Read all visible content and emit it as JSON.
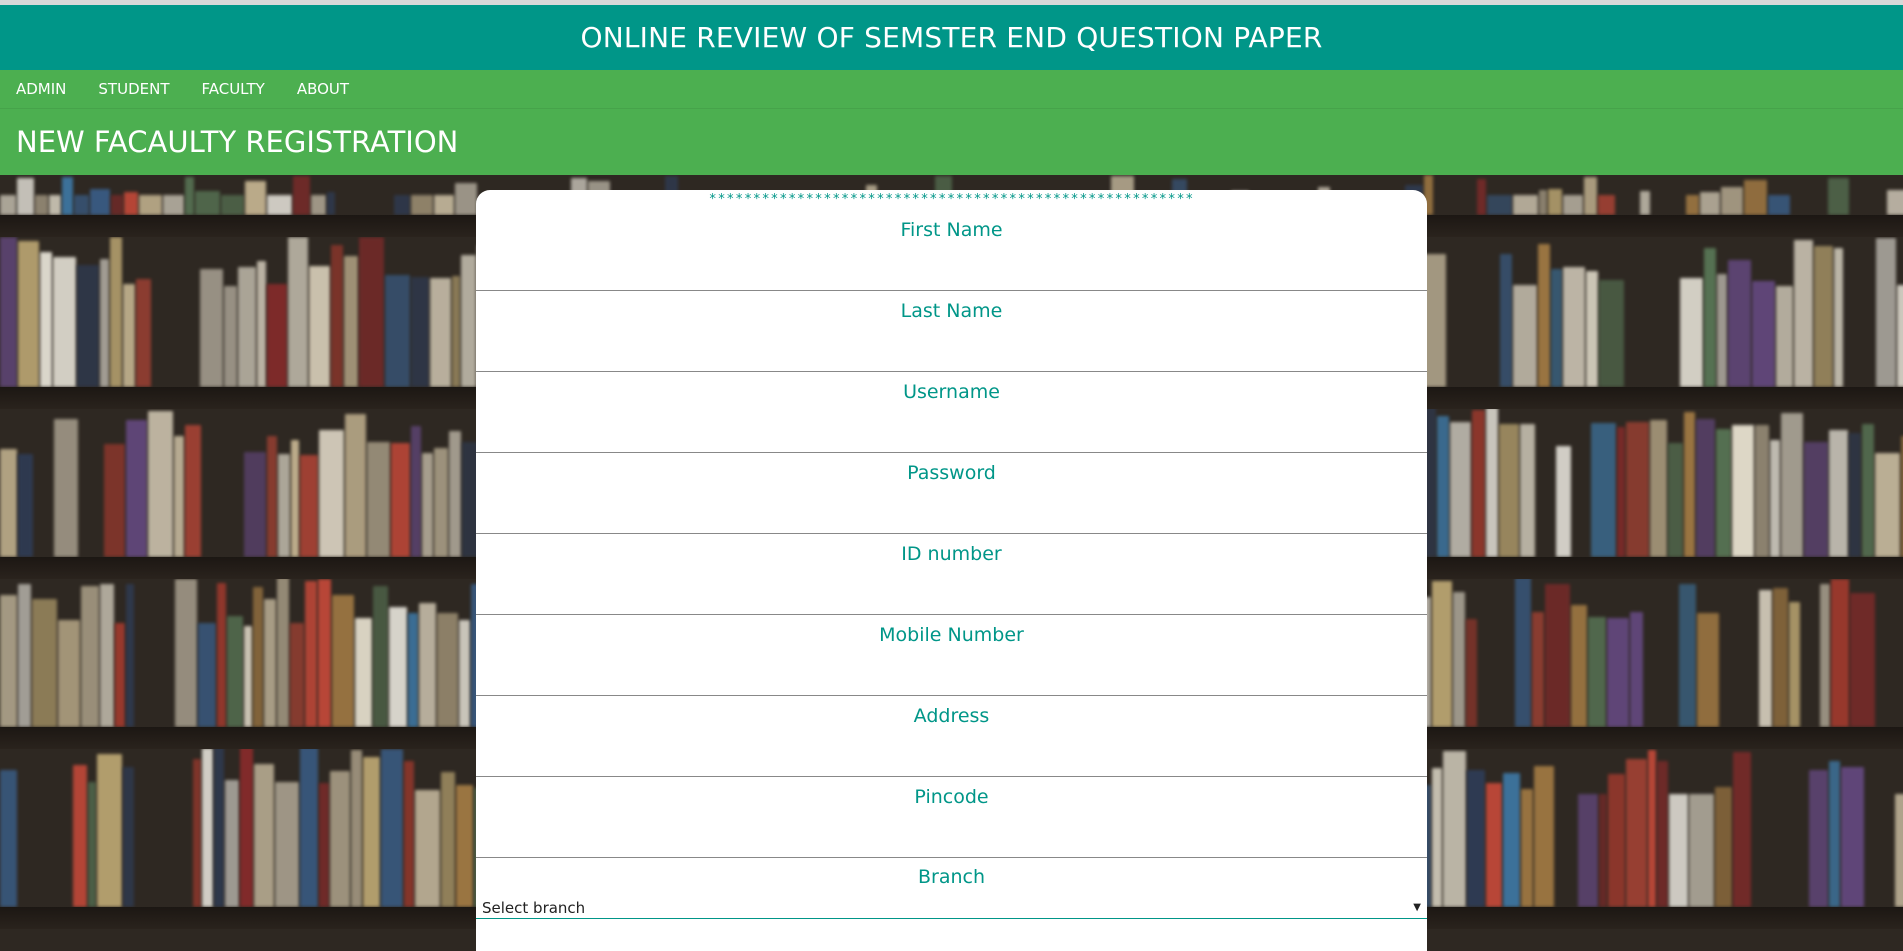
{
  "header": {
    "title": "ONLINE REVIEW OF SEMSTER END QUESTION PAPER"
  },
  "nav": {
    "items": [
      "ADMIN",
      "STUDENT",
      "FACULTY",
      "ABOUT"
    ]
  },
  "page": {
    "heading": "NEW FACAULTY REGISTRATION"
  },
  "form": {
    "stars": "*******************************************************",
    "fields": [
      {
        "label": "First Name",
        "value": ""
      },
      {
        "label": "Last Name",
        "value": ""
      },
      {
        "label": "Username",
        "value": ""
      },
      {
        "label": "Password",
        "value": ""
      },
      {
        "label": "ID number",
        "value": ""
      },
      {
        "label": "Mobile Number",
        "value": ""
      },
      {
        "label": "Address",
        "value": ""
      },
      {
        "label": "Pincode",
        "value": ""
      }
    ],
    "branch": {
      "label": "Branch",
      "selected": "Select branch"
    }
  },
  "colors": {
    "teal": "#009688",
    "green": "#4caf50"
  }
}
